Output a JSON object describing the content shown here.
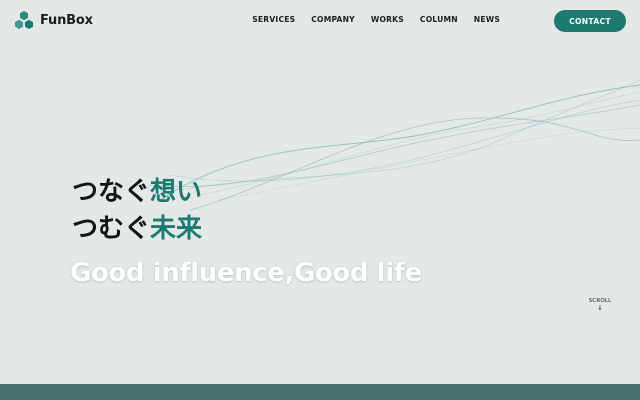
{
  "brand": {
    "name": "FunBox",
    "accent_color": "#1c7a71",
    "logo_icon": "hexagon-cluster-icon"
  },
  "nav": {
    "items": [
      {
        "label": "SERVICES"
      },
      {
        "label": "COMPANY"
      },
      {
        "label": "WORKS"
      },
      {
        "label": "COLUMN"
      },
      {
        "label": "NEWS"
      }
    ],
    "contact_label": "CONTACT"
  },
  "hero": {
    "line1_plain": "つなぐ",
    "line1_accent": "想い",
    "line2_plain": "つむぐ",
    "line2_accent": "未来",
    "tagline": "Good influence,Good life"
  },
  "scroll": {
    "label": "SCROLL",
    "arrow": "↓"
  },
  "colors": {
    "background": "#e4e9e8",
    "footer_band": "#46716f",
    "wave_lines": "#7fb3ad"
  }
}
